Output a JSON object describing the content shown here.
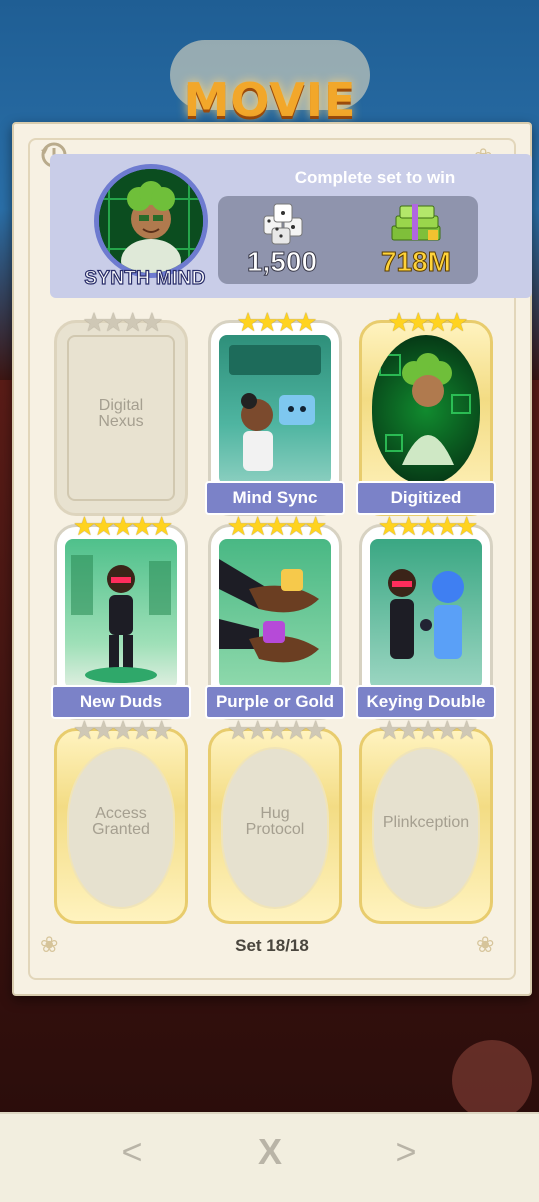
{
  "background": {
    "title": "MOVIE"
  },
  "header": {
    "subtitle": "Complete set to win",
    "set_name": "SYNTH MIND",
    "rewards": {
      "dice": "1,500",
      "cash": "718M"
    },
    "icons": [
      "history-icon",
      "dice-icon",
      "cash-stack-icon"
    ]
  },
  "cards": [
    {
      "name": "Digital Nexus",
      "stars": 4,
      "state": "empty-normal"
    },
    {
      "name": "Mind Sync",
      "stars": 4,
      "state": "collected"
    },
    {
      "name": "Digitized",
      "stars": 4,
      "state": "collected-gold"
    },
    {
      "name": "New Duds",
      "stars": 5,
      "state": "collected"
    },
    {
      "name": "Purple or Gold",
      "stars": 5,
      "state": "collected"
    },
    {
      "name": "Keying Double",
      "stars": 5,
      "state": "collected"
    },
    {
      "name": "Access Granted",
      "stars": 5,
      "state": "empty-gold"
    },
    {
      "name": "Hug Protocol",
      "stars": 5,
      "state": "empty-gold"
    },
    {
      "name": "Plinkception",
      "stars": 5,
      "state": "empty-gold"
    }
  ],
  "footer": {
    "set_progress": "Set 18/18"
  },
  "nav": {
    "prev": "<",
    "close": "X",
    "next": ">"
  },
  "colors": {
    "label_bg": "#7b82c8",
    "header_bg": "#c9cde8",
    "star_gold": "#ffd31f",
    "modal_bg": "#f7f1e3"
  }
}
